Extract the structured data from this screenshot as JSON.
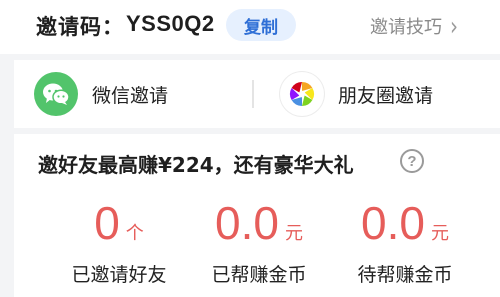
{
  "invite": {
    "label": "邀请码：",
    "code": "YSS0Q2",
    "copy_label": "复制",
    "tips_label": "邀请技巧",
    "tips_chevron": "›"
  },
  "share": {
    "wechat_label": "微信邀请",
    "moments_label": "朋友圈邀请",
    "wechat_icon": "wechat-icon",
    "moments_icon": "moments-icon"
  },
  "earnings": {
    "title": "邀好友最高赚¥224，还有豪华大礼",
    "help_icon_glyph": "?",
    "stats": [
      {
        "value": "0",
        "unit": "个",
        "label": "已邀请好友"
      },
      {
        "value": "0.0",
        "unit": "元",
        "label": "已帮赚金币"
      },
      {
        "value": "0.0",
        "unit": "元",
        "label": "待帮赚金币"
      }
    ]
  },
  "colors": {
    "accent_blue": "#2f6fd6",
    "copy_bg": "#e6f0fe",
    "wechat_green": "#52c46b",
    "stat_red": "#e65d5a"
  }
}
